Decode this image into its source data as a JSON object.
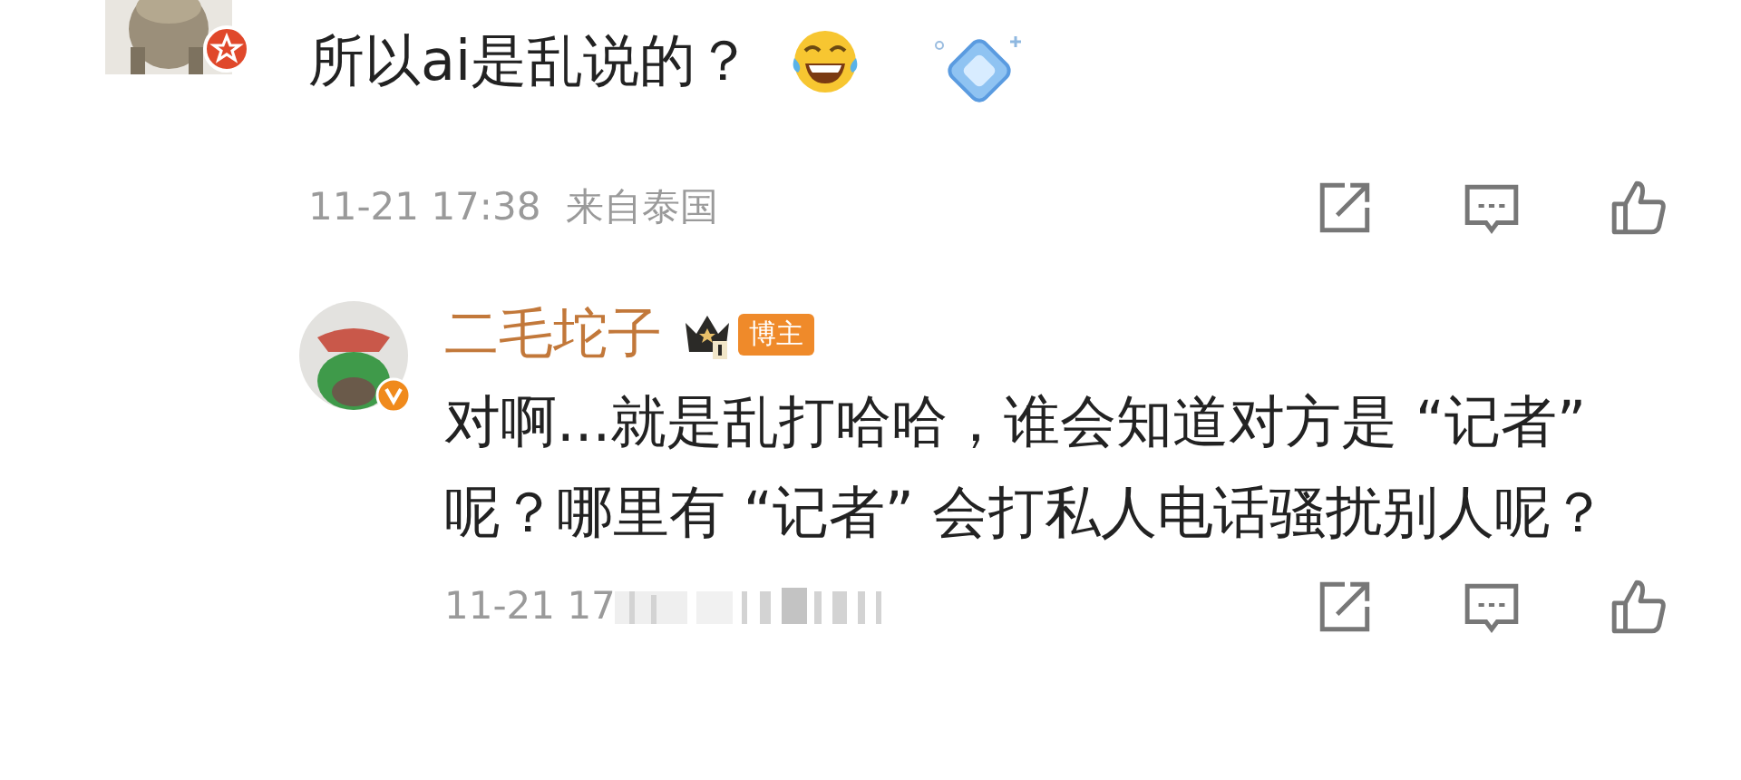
{
  "comment": {
    "text": "所以ai是乱说的？",
    "time": "11-21 17:38",
    "location": "来自泰国"
  },
  "reply": {
    "author": "二毛坨子",
    "badge": "博主",
    "text": "对啊...就是乱打哈哈，谁会知道对方是 “记者” 呢？哪里有 “记者” 会打私人电话骚扰别人呢？",
    "time": "11-21 17",
    "redacted": true
  }
}
